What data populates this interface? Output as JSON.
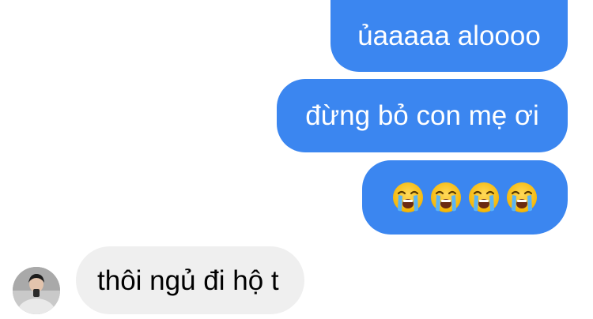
{
  "conversation": {
    "messages": [
      {
        "direction": "outgoing",
        "text": "ủaaaaa aloooo"
      },
      {
        "direction": "outgoing",
        "text": "đừng bỏ con mẹ ơi"
      },
      {
        "direction": "outgoing",
        "emoji": "loudly-crying-face",
        "count": 4
      },
      {
        "direction": "incoming",
        "text": "thôi ngủ đi hộ t"
      }
    ],
    "colors": {
      "outgoing_bubble": "#3b86f0",
      "incoming_bubble": "#efefef",
      "outgoing_text": "#ffffff",
      "incoming_text": "#000000"
    }
  }
}
